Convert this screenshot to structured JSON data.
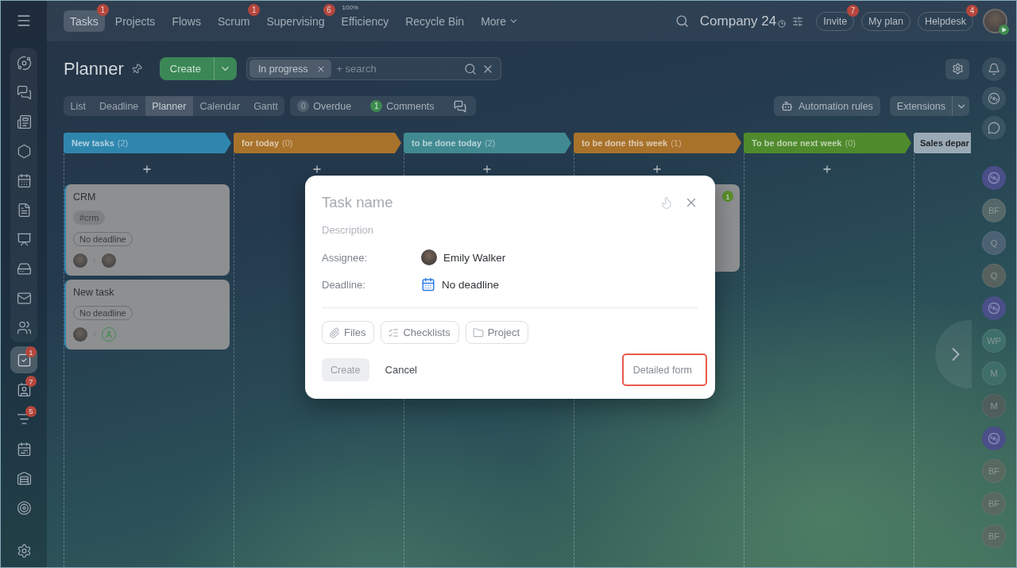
{
  "top_bar": {
    "tabs": [
      {
        "label": "Tasks",
        "kind": "link",
        "selected": true,
        "badge": "1"
      },
      {
        "label": "Projects",
        "kind": "link",
        "selected": false
      },
      {
        "label": "Flows",
        "kind": "link",
        "selected": false
      },
      {
        "label": "Scrum",
        "kind": "link",
        "selected": false,
        "badge": "1"
      },
      {
        "label": "Supervising",
        "kind": "link",
        "selected": false,
        "badge": "6"
      },
      {
        "label": "Efficiency",
        "kind": "link",
        "selected": false,
        "note": "100%"
      },
      {
        "label": "Recycle Bin",
        "kind": "link",
        "selected": false
      },
      {
        "label": "More",
        "kind": "dropdown",
        "selected": false
      }
    ],
    "company": "Company 24",
    "buttons": [
      {
        "label": "Invite",
        "badge": "7"
      },
      {
        "label": "My plan"
      },
      {
        "label": "Helpdesk",
        "badge": "4"
      }
    ]
  },
  "left_sidebar": {
    "pinned_items": [
      {
        "selected": false
      },
      {
        "selected": false
      },
      {
        "selected": false
      },
      {
        "selected": false
      },
      {
        "selected": false
      },
      {
        "selected": false
      },
      {
        "selected": false
      },
      {
        "selected": false
      },
      {
        "selected": false
      },
      {
        "selected": false
      }
    ],
    "items": [
      {
        "selected": true,
        "badge": "1"
      },
      {
        "selected": false,
        "badge": "7"
      },
      {
        "selected": false,
        "badge": "5"
      },
      {
        "selected": false
      },
      {
        "selected": false
      },
      {
        "selected": false
      }
    ]
  },
  "toolbar": {
    "title": "Planner",
    "create_button": "Create",
    "filter": {
      "chips": [
        {
          "label": "In progress"
        }
      ],
      "placeholder": "+ search"
    },
    "view_tabs": [
      {
        "label": "List",
        "selected": false
      },
      {
        "label": "Deadline",
        "selected": false
      },
      {
        "label": "Planner",
        "selected": true
      },
      {
        "label": "Calendar",
        "selected": false
      },
      {
        "label": "Gantt",
        "selected": false
      }
    ],
    "counters": [
      {
        "count": "0",
        "label": "Overdue",
        "active": false
      },
      {
        "count": "1",
        "label": "Comments",
        "active": true
      }
    ],
    "automation_button": "Automation rules",
    "extensions_button": "Extensions"
  },
  "board": {
    "columns": [
      {
        "title": "New tasks",
        "count": "(2)",
        "color": "#2f86ad",
        "cards": [
          {
            "title": "CRM",
            "tags": [
              "#crm"
            ],
            "deadline": "No deadline",
            "responsible": {
              "kind": "photo"
            }
          },
          {
            "title": "New task",
            "deadline": "No deadline",
            "responsible": {
              "kind": "unassigned"
            }
          }
        ]
      },
      {
        "title": "for today",
        "count": "(0)",
        "color": "#a8722b"
      },
      {
        "title": "to be done today",
        "count": "(2)",
        "color": "#418a92"
      },
      {
        "title": "to be done this week",
        "count": "(1)",
        "color": "#a8722b",
        "cards": [
          {
            "comments": "1"
          }
        ]
      },
      {
        "title": "To be done next week",
        "count": "(0)",
        "color": "#4f8a2c"
      },
      {
        "title": "Sales depar",
        "color": "#9aaab4"
      }
    ]
  },
  "right_rail": {
    "chats": [
      {
        "kind": "logo",
        "color": "#4b4f88"
      },
      {
        "kind": "initials",
        "initials": "BF",
        "color": "#566869"
      },
      {
        "kind": "initials",
        "initials": "Q",
        "color": "#4c6173"
      },
      {
        "kind": "initials",
        "initials": "Q",
        "color": "#57625f"
      },
      {
        "kind": "logo",
        "color": "#4b4f88"
      },
      {
        "kind": "initials",
        "initials": "WP",
        "color": "#3f6f6b"
      },
      {
        "kind": "initials",
        "initials": "M",
        "color": "#3f6e69"
      },
      {
        "kind": "initials",
        "initials": "M",
        "color": "#4f5d5b"
      },
      {
        "kind": "logo",
        "color": "#4b4f88"
      },
      {
        "kind": "initials",
        "initials": "BF",
        "color": "#58695f"
      },
      {
        "kind": "initials",
        "initials": "BF",
        "color": "#58695f"
      },
      {
        "kind": "initials",
        "initials": "BF",
        "color": "#58695f"
      }
    ]
  },
  "dialog": {
    "title_placeholder": "Task name",
    "description_placeholder": "Description",
    "fields": [
      {
        "kind": "user",
        "label": "Assignee:",
        "value": "Emily Walker"
      },
      {
        "kind": "date",
        "label": "Deadline:",
        "value": "No deadline"
      }
    ],
    "attachments": [
      {
        "kind": "files",
        "label": "Files"
      },
      {
        "kind": "checklists",
        "label": "Checklists"
      },
      {
        "kind": "project",
        "label": "Project"
      }
    ],
    "create_button": {
      "label": "Create",
      "disabled": true
    },
    "cancel_button": "Cancel",
    "detailed_form_button": {
      "label": "Detailed form",
      "highlighted": true
    }
  }
}
